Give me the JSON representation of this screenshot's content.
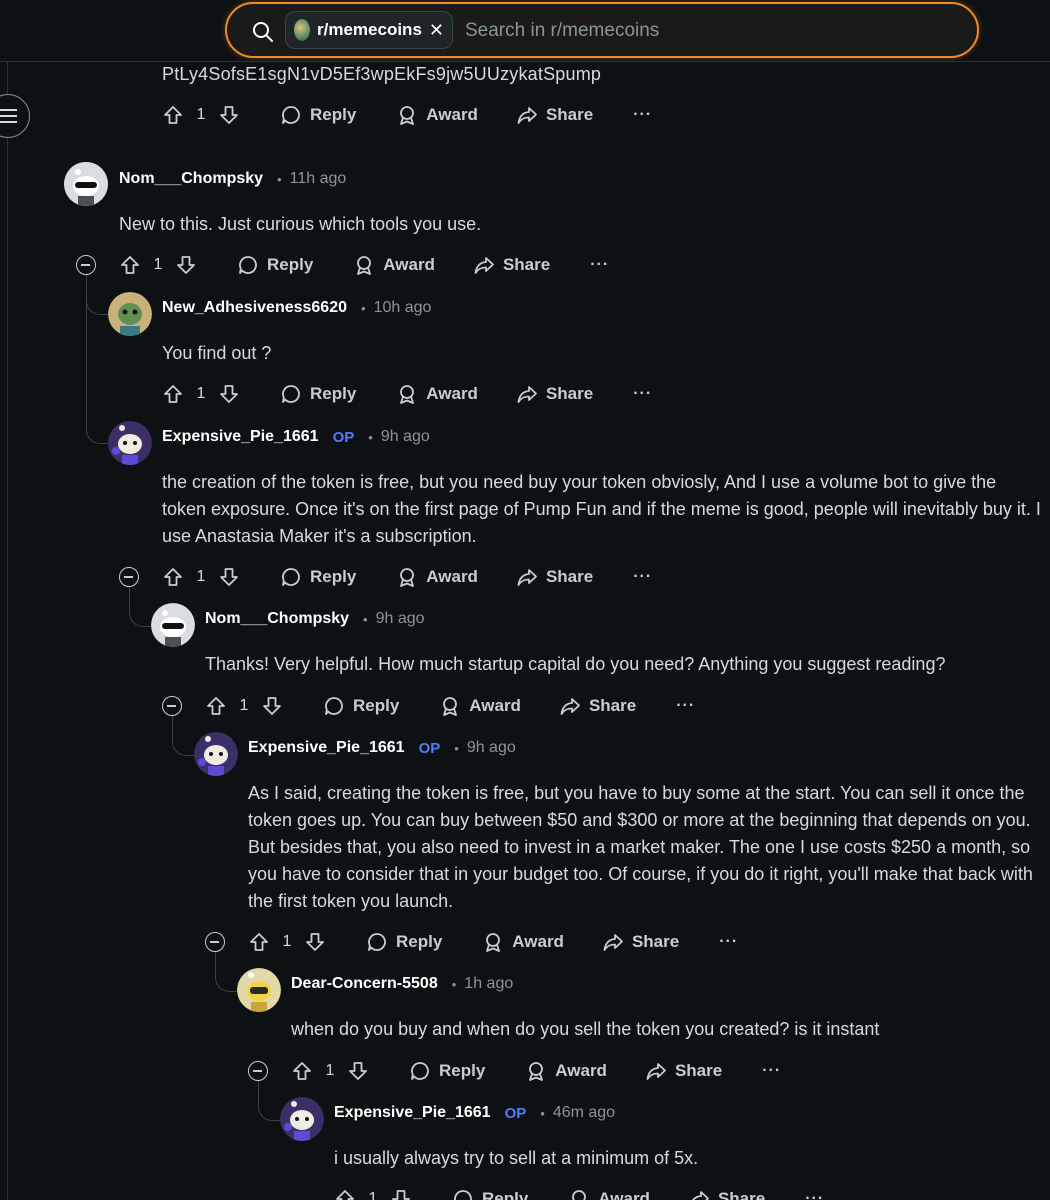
{
  "search": {
    "subreddit_chip": "r/memecoins",
    "placeholder": "Search in r/memecoins"
  },
  "top_fragment": {
    "text": "PtLy4SofsE1sgN1vD5Ef3wpEkFs9jw5UUzykatSpump",
    "votes": "1"
  },
  "actions": {
    "reply": "Reply",
    "award": "Award",
    "share": "Share",
    "more": "···"
  },
  "comments": [
    {
      "username": "Nom___Chompsky",
      "op": "",
      "time": "11h ago",
      "body": "New to this. Just curious which tools you use.",
      "votes": "1"
    },
    {
      "username": "New_Adhesiveness6620",
      "op": "",
      "time": "10h ago",
      "body": "You find out ?",
      "votes": "1"
    },
    {
      "username": "Expensive_Pie_1661",
      "op": "OP",
      "time": "9h ago",
      "body": "the creation of the token is free, but you need buy your token obviosly, And I use a volume bot to give the token exposure. Once it's on the first page of Pump Fun and if the meme is good, people will inevitably buy it. I use Anastasia Maker it's a subscription.",
      "votes": "1"
    },
    {
      "username": "Nom___Chompsky",
      "op": "",
      "time": "9h ago",
      "body": "Thanks! Very helpful. How much startup capital do you need? Anything you suggest reading?",
      "votes": "1"
    },
    {
      "username": "Expensive_Pie_1661",
      "op": "OP",
      "time": "9h ago",
      "body": "As I said, creating the token is free, but you have to buy some at the start. You can sell it once the token goes up. You can buy between $50 and $300 or more at the beginning that depends on you. But besides that, you also need to invest in a market maker. The one I use costs $250 a month, so you have to consider that in your budget too. Of course, if you do it right, you'll make that back with the first token you launch.",
      "votes": "1"
    },
    {
      "username": "Dear-Concern-5508",
      "op": "",
      "time": "1h ago",
      "body": "when do you buy and when do you sell the token you created? is it instant",
      "votes": "1"
    },
    {
      "username": "Expensive_Pie_1661",
      "op": "OP",
      "time": "46m ago",
      "body": "i usually always try to sell at a minimum of 5x.",
      "votes": "1"
    }
  ],
  "colors": {
    "background": "#0e1113",
    "search_border": "#f08a24",
    "op_badge": "#4f7dff",
    "muted": "#8a9599"
  }
}
